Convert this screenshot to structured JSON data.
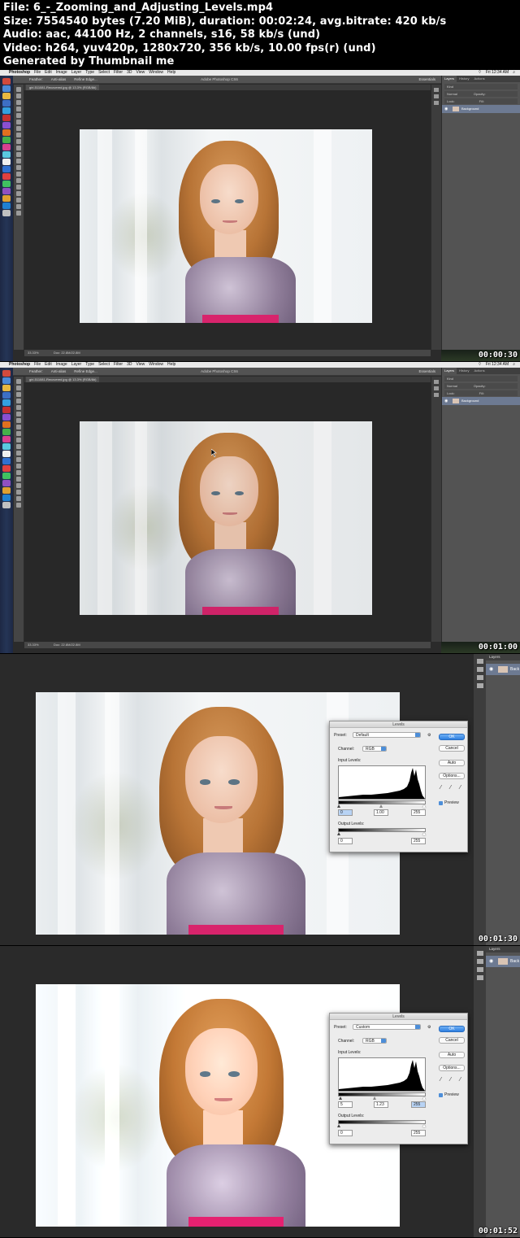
{
  "header": {
    "file": "File: 6_-_Zooming_and_Adjusting_Levels.mp4",
    "size": "Size: 7554540 bytes (7.20 MiB), duration: 00:02:24, avg.bitrate: 420 kb/s",
    "audio": "Audio: aac, 44100 Hz, 2 channels, s16, 58 kb/s (und)",
    "video": "Video: h264, yuv420p, 1280x720, 356 kb/s, 10.00 fps(r) (und)",
    "generated": "Generated by Thumbnail me"
  },
  "frames": [
    {
      "timestamp": "00:00:30"
    },
    {
      "timestamp": "00:01:00"
    },
    {
      "timestamp": "00:01:30"
    },
    {
      "timestamp": "00:01:52"
    }
  ],
  "photoshop": {
    "menubar": {
      "app": "Photoshop",
      "items": [
        "File",
        "Edit",
        "Image",
        "Layer",
        "Type",
        "Select",
        "Filter",
        "3D",
        "View",
        "Window",
        "Help"
      ],
      "clock": "Fri 12:34 AM"
    },
    "window_title": "Adobe Photoshop CS6",
    "options": {
      "feather": "Feather:",
      "anti_alias": "Anti-alias",
      "refine_edge": "Refine Edge...",
      "workspace": "Essentials"
    },
    "doc_tab_1": "girl-511081-Recovered.jpg @ 13.3% (RGB/8#)",
    "doc_tab_2": "girl-511081-Recovered.jpg @ 13.3% (RGB/8#)",
    "status": {
      "zoom": "33.33%",
      "doc": "Doc: 22.8M/22.8M"
    },
    "panel": {
      "tabs": [
        "Layers",
        "History",
        "Actions"
      ],
      "kind": "Kind",
      "blend_mode": "Normal",
      "opacity": "Opacity:",
      "lock": "Lock:",
      "fill": "Fill:",
      "layer_name": "Background"
    },
    "side_panel": {
      "tab": "Layers",
      "layer_short": "Back"
    }
  },
  "levels_dialogs": [
    {
      "title": "Levels",
      "preset_label": "Preset:",
      "preset": "Default",
      "channel_label": "Channel:",
      "channel": "RGB",
      "input_levels_label": "Input Levels:",
      "input": [
        "0",
        "1.00",
        "255"
      ],
      "output_levels_label": "Output Levels:",
      "output": [
        "0",
        "255"
      ],
      "buttons": {
        "ok": "OK",
        "cancel": "Cancel",
        "auto": "Auto",
        "options": "Options..."
      },
      "preview_label": "Preview"
    },
    {
      "title": "Levels",
      "preset_label": "Preset:",
      "preset": "Custom",
      "channel_label": "Channel:",
      "channel": "RGB",
      "input_levels_label": "Input Levels:",
      "input": [
        "5",
        "1.23",
        "255"
      ],
      "output_levels_label": "Output Levels:",
      "output": [
        "0",
        "255"
      ],
      "buttons": {
        "ok": "OK",
        "cancel": "Cancel",
        "auto": "Auto",
        "options": "Options..."
      },
      "preview_label": "Preview"
    }
  ],
  "colors": {
    "ps_panel": "#535353",
    "ps_canvas": "#282828",
    "dock_blue": "#253556",
    "ok_button": "#2d7fe0",
    "layer_selected": "#6d7a92",
    "dress_trim": "#d8246c"
  }
}
